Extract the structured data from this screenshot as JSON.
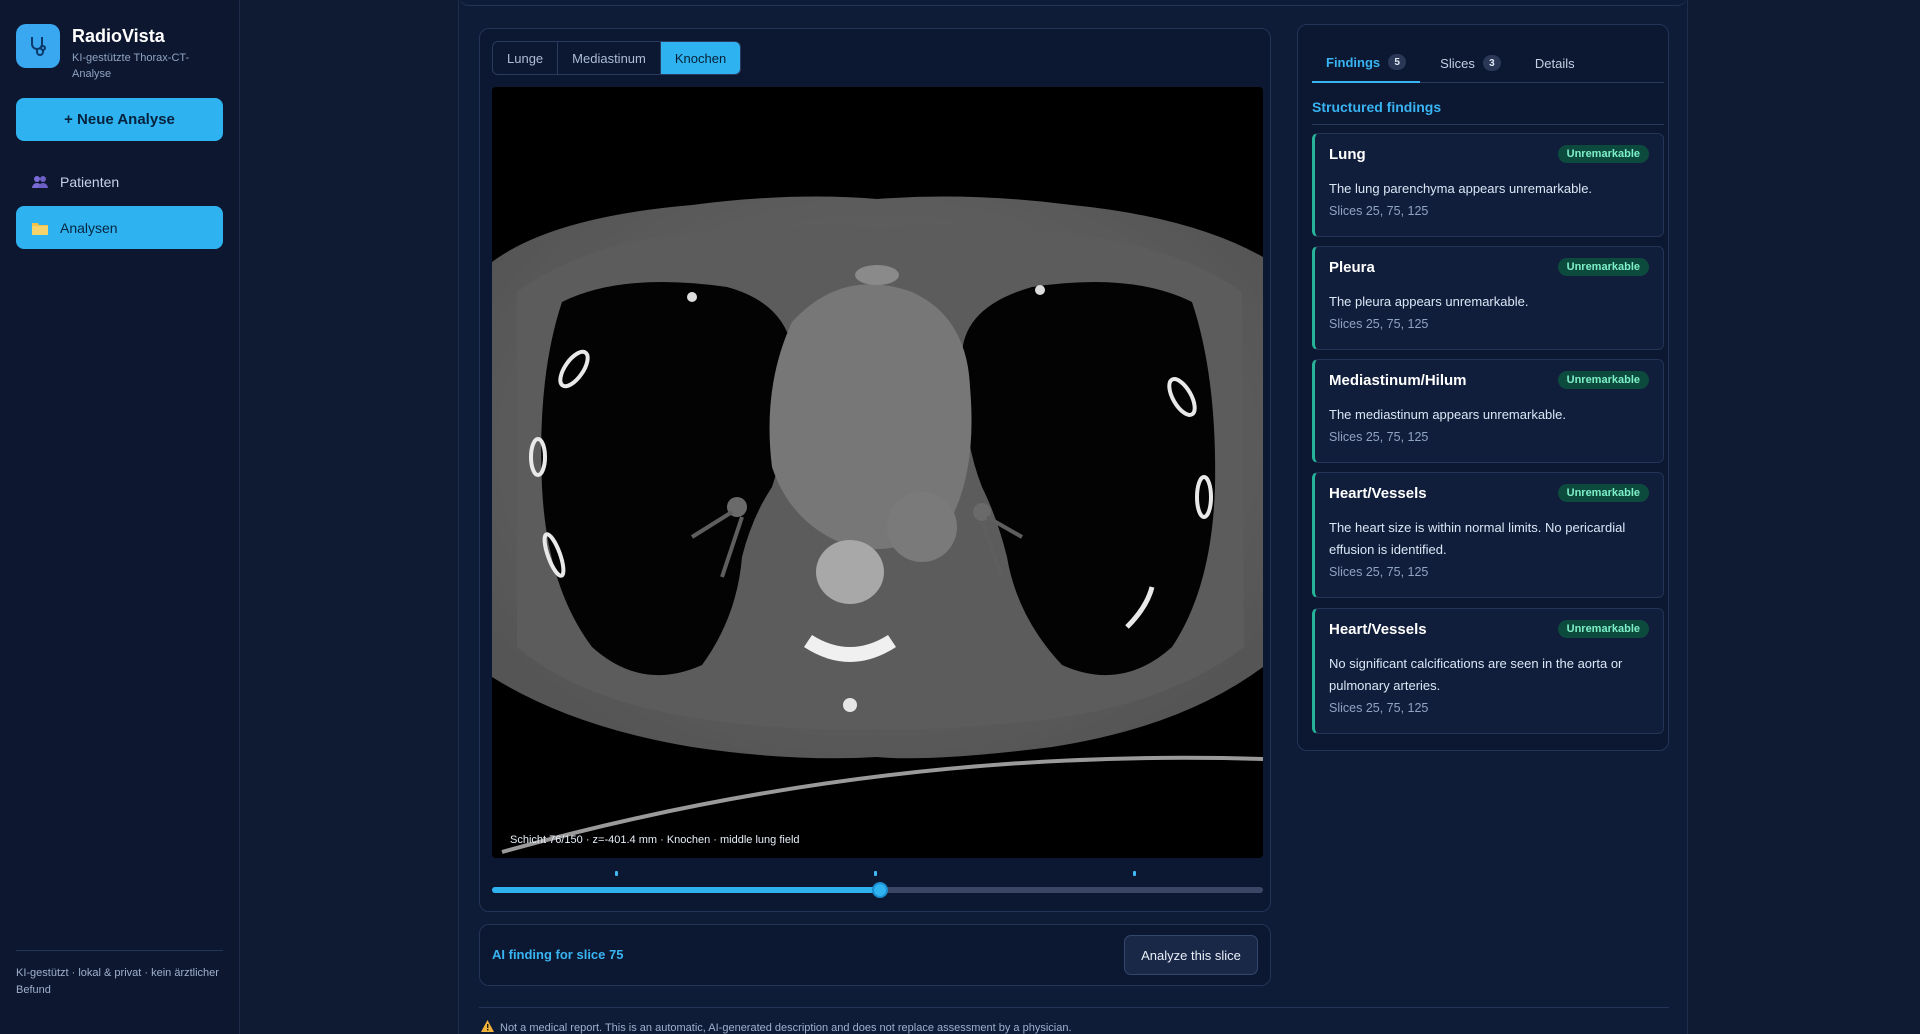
{
  "sidebar": {
    "app_name": "RadioVista",
    "app_subtitle": "KI-gestützte Thorax-CT-Analyse",
    "new_analysis_label": "+ Neue Analyse",
    "nav": [
      {
        "label": "Patienten",
        "icon": "users-icon",
        "active": false
      },
      {
        "label": "Analysen",
        "icon": "folder-icon",
        "active": true
      }
    ],
    "footer_text": "KI-gestützt · lokal & privat · kein ärztlicher Befund"
  },
  "viewer": {
    "window_tabs": [
      {
        "label": "Lunge",
        "active": false
      },
      {
        "label": "Mediastinum",
        "active": false
      },
      {
        "label": "Knochen",
        "active": true
      }
    ],
    "caption": "Schicht 76/150 · z=-401.4 mm · Knochen · middle lung field",
    "slider": {
      "current_slice": 76,
      "total_slices": 150,
      "marked_slices": [
        25,
        75,
        125
      ]
    }
  },
  "ai_panel": {
    "title": "AI finding for slice 75",
    "analyze_label": "Analyze this slice"
  },
  "disclaimer": "Not a medical report. This is an automatic, AI-generated description and does not replace assessment by a physician.",
  "findings_panel": {
    "tabs": [
      {
        "label": "Findings",
        "count": "5",
        "active": true
      },
      {
        "label": "Slices",
        "count": "3",
        "active": false
      },
      {
        "label": "Details",
        "count": "",
        "active": false
      }
    ],
    "section_title": "Structured findings",
    "items": [
      {
        "region": "Lung",
        "status": "Unremarkable",
        "text": "The lung parenchyma appears unremarkable.",
        "slices": "Slices 25, 75, 125"
      },
      {
        "region": "Pleura",
        "status": "Unremarkable",
        "text": "The pleura appears unremarkable.",
        "slices": "Slices 25, 75, 125"
      },
      {
        "region": "Mediastinum/Hilum",
        "status": "Unremarkable",
        "text": "The mediastinum appears unremarkable.",
        "slices": "Slices 25, 75, 125"
      },
      {
        "region": "Heart/Vessels",
        "status": "Unremarkable",
        "text": "The heart size is within normal limits. No pericardial effusion is identified.",
        "slices": "Slices 25, 75, 125"
      },
      {
        "region": "Heart/Vessels",
        "status": "Unremarkable",
        "text": "No significant calcifications are seen in the aorta or pulmonary arteries.",
        "slices": "Slices 25, 75, 125"
      }
    ]
  },
  "colors": {
    "accent": "#2eb2f0",
    "status_ok": "#27b39a",
    "background": "#0f1a33"
  }
}
